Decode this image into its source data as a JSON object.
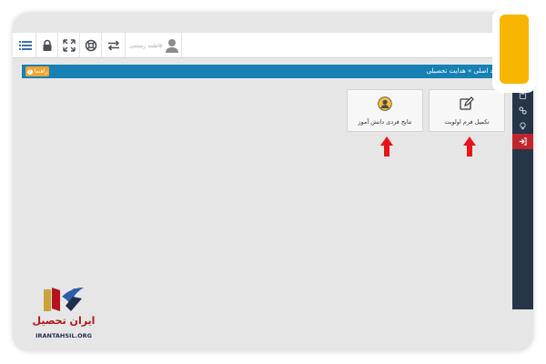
{
  "topbar": {
    "user_name": "فاطمه رستمی",
    "icons": [
      "menu-icon",
      "lock-icon",
      "expand-icon",
      "lifebuoy-icon",
      "switch-icon",
      "user-icon"
    ]
  },
  "nav": {
    "help_label": "راهنما",
    "breadcrumb": "ورود اصلی » هدایت تحصیلی"
  },
  "cards": [
    {
      "label": "تکمیل فرم اولویت",
      "icon": "edit-icon"
    },
    {
      "label": "نتایج فردی دانش آموز",
      "icon": "user-circle-icon"
    }
  ],
  "side_icons": [
    "calculator-icon",
    "link-icon",
    "bulb-icon",
    "exit-icon"
  ],
  "logo": {
    "text_fa": "ایران تحصیل",
    "text_en": "IRANTAHSIL.ORG"
  },
  "colors": {
    "nav": "#1781b4",
    "help_button": "#f0a431",
    "side_panel": "#26354a",
    "exit": "#c0262d",
    "arrow": "#e8141b",
    "tile": "#f7b500"
  }
}
